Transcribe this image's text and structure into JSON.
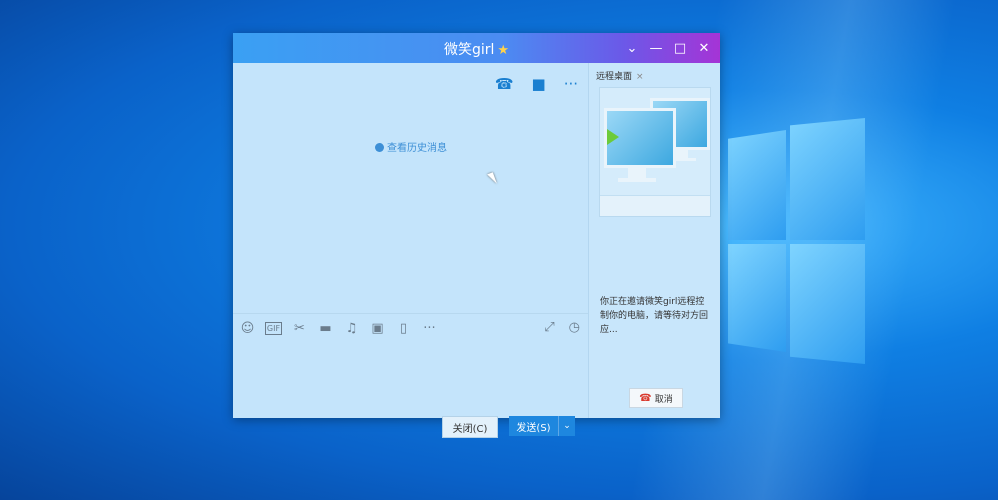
{
  "window": {
    "title": "微笑girl",
    "star": "★",
    "controls": {
      "dropdown": "⌄",
      "minimize": "—",
      "maximize": "□",
      "close": "✕"
    }
  },
  "chat": {
    "top_icons": {
      "voice_call": "☎",
      "video_call": "■",
      "more": "···"
    },
    "history_link": "查看历史消息",
    "toolbar_icons": {
      "emoji": "☺",
      "gif": "GIF",
      "screenshot": "✂",
      "file": "▬",
      "music": "♫",
      "image": "▣",
      "shake": "▯",
      "more": "···",
      "expand": "⤢",
      "history": "◷"
    },
    "close_button": "关闭(C)",
    "send_button": "发送(S)",
    "send_dropdown": "⌄"
  },
  "remote": {
    "tab_label": "远程桌面",
    "tab_close": "×",
    "invite_text": "你正在邀请微笑girl远程控制你的电脑，请等待对方回应...",
    "cancel_icon": "☎",
    "cancel_label": "取消"
  },
  "colors": {
    "title_start": "#3aa0f3",
    "title_end": "#a534d6",
    "send": "#1e87df",
    "cancel_icon": "#d93a2e"
  }
}
